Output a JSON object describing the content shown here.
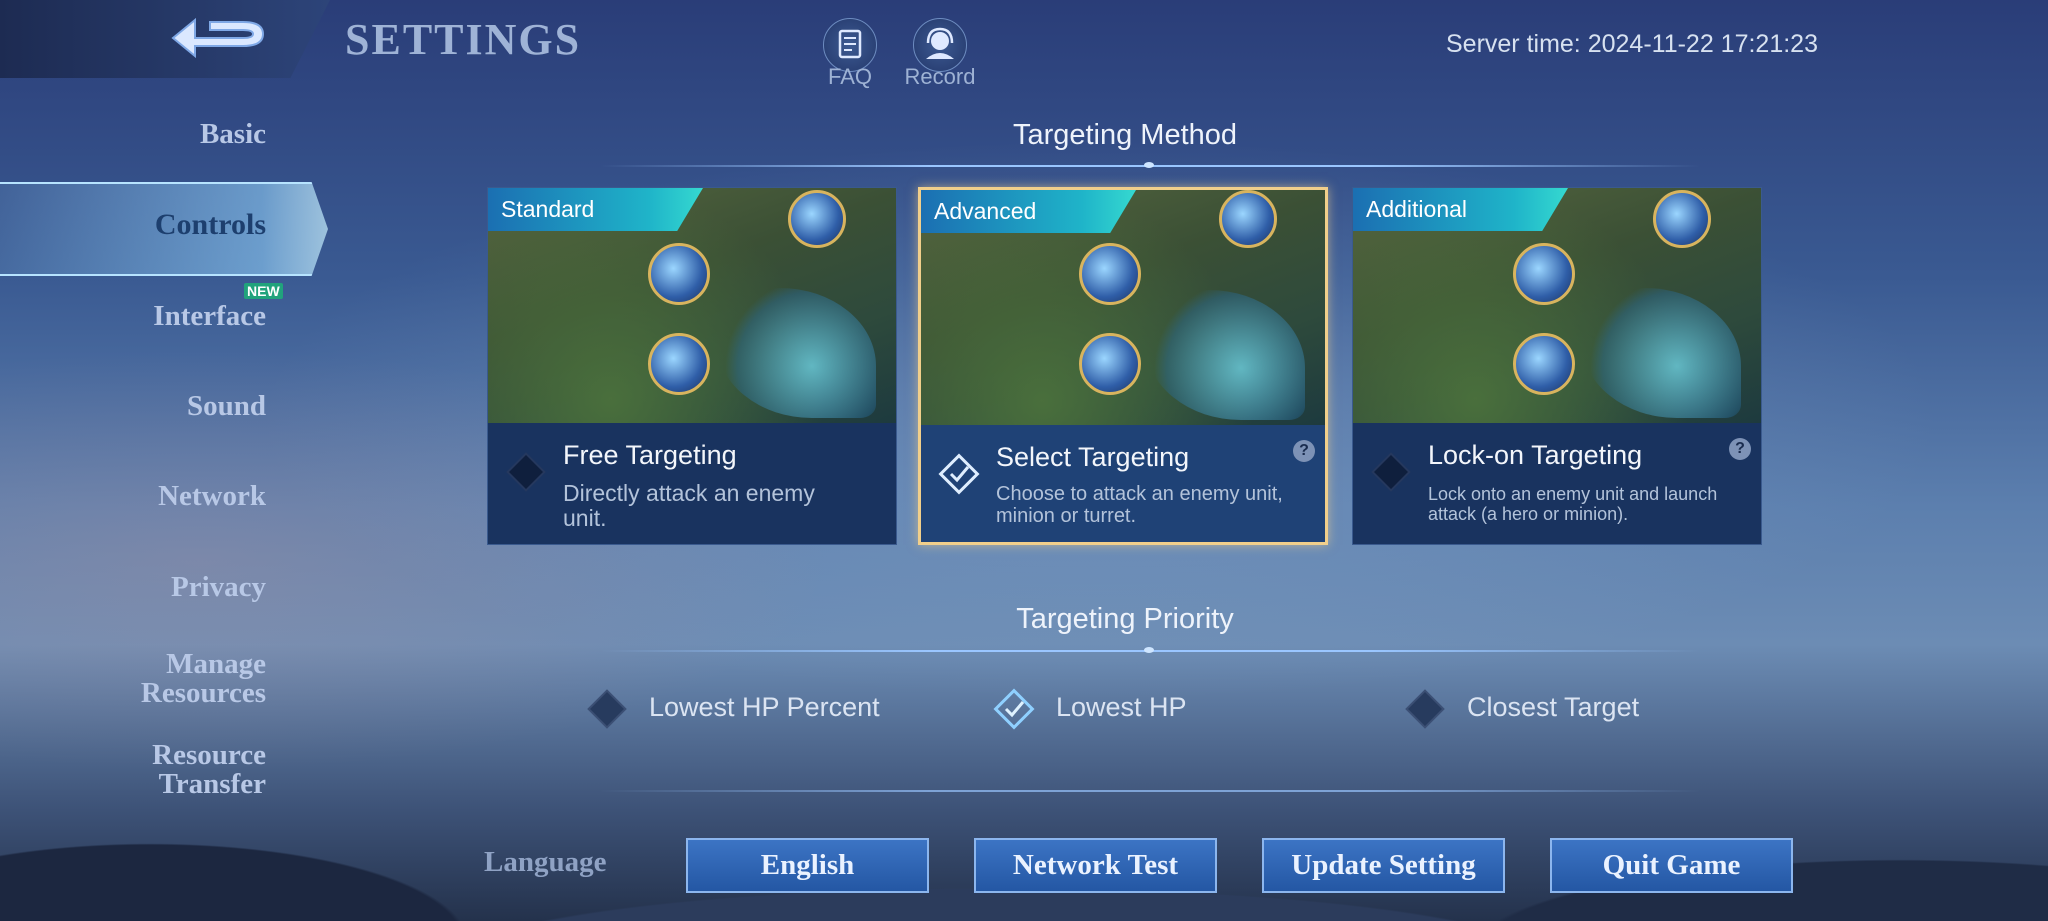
{
  "header": {
    "title": "SETTINGS",
    "faq_label": "FAQ",
    "record_label": "Record",
    "server_time": "Server time: 2024-11-22 17:21:23"
  },
  "sidebar": {
    "items": [
      {
        "label": "Basic"
      },
      {
        "label": "Controls",
        "active": true
      },
      {
        "label": "Interface",
        "badge": "NEW"
      },
      {
        "label": "Sound"
      },
      {
        "label": "Network"
      },
      {
        "label": "Privacy"
      },
      {
        "label": "Manage\nResources"
      },
      {
        "label": "Resource\nTransfer"
      }
    ]
  },
  "targeting_method": {
    "title": "Targeting Method",
    "cards": [
      {
        "tag": "Standard",
        "title": "Free Targeting",
        "description": "Directly attack an enemy unit.",
        "selected": false
      },
      {
        "tag": "Advanced",
        "title": "Select Targeting",
        "description": "Choose to attack an enemy unit, minion or turret.",
        "selected": true
      },
      {
        "tag": "Additional",
        "title": "Lock-on Targeting",
        "description": "Lock onto an enemy unit and launch attack (a hero or minion).",
        "selected": false
      }
    ],
    "help_glyph": "?"
  },
  "targeting_priority": {
    "title": "Targeting Priority",
    "options": [
      {
        "label": "Lowest HP Percent",
        "selected": false
      },
      {
        "label": "Lowest HP",
        "selected": true
      },
      {
        "label": "Closest Target",
        "selected": false
      }
    ]
  },
  "footer": {
    "language_label": "Language",
    "language_button": "English",
    "network_test_button": "Network Test",
    "update_setting_button": "Update Setting",
    "quit_game_button": "Quit Game"
  },
  "colors": {
    "selected_border": "#f1cf8b",
    "button_fill": "#2457a4",
    "accent_teal": "#1fb4c9"
  },
  "icons": {
    "back": "back-arrow-icon",
    "faq": "faq-document-icon",
    "record": "record-headset-icon",
    "check": "diamond-check-icon"
  }
}
